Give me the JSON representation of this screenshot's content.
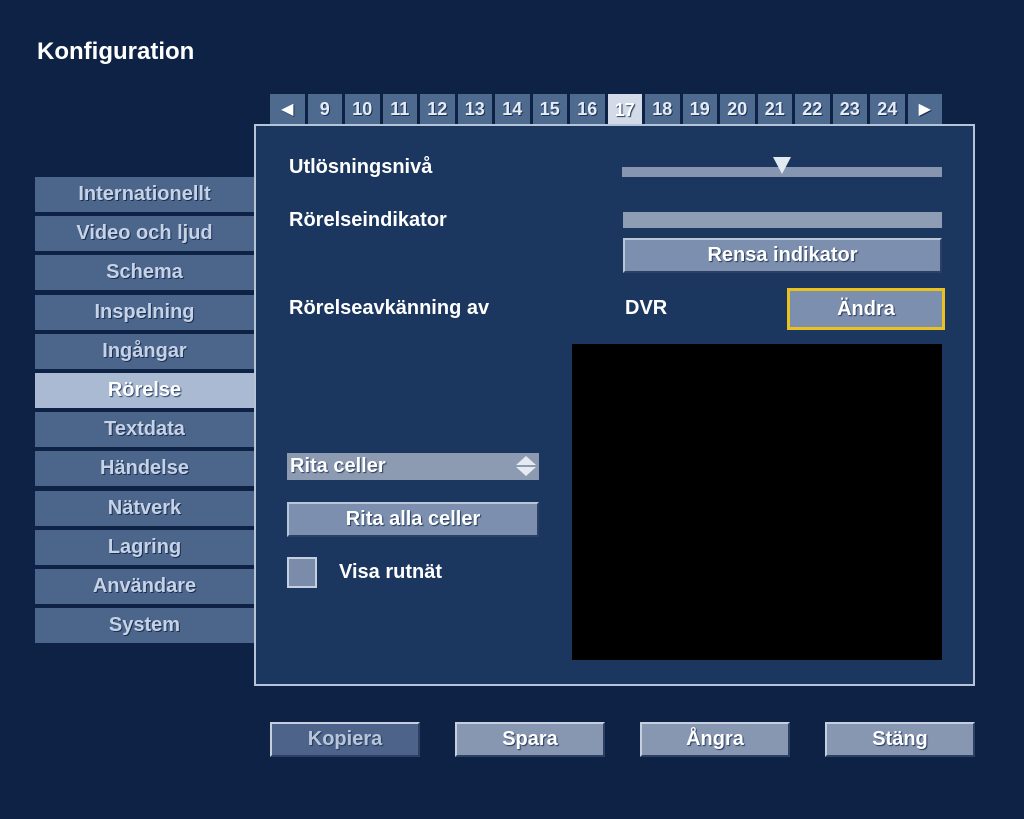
{
  "header": {
    "title": "Konfiguration"
  },
  "tabs": {
    "prev_icon": "◀",
    "next_icon": "▶",
    "items": [
      "9",
      "10",
      "11",
      "12",
      "13",
      "14",
      "15",
      "16",
      "17",
      "18",
      "19",
      "20",
      "21",
      "22",
      "23",
      "24"
    ],
    "active": "17"
  },
  "sidebar": {
    "items": [
      {
        "label": "Internationellt"
      },
      {
        "label": "Video och ljud"
      },
      {
        "label": "Schema"
      },
      {
        "label": "Inspelning"
      },
      {
        "label": "Ingångar"
      },
      {
        "label": "Rörelse"
      },
      {
        "label": "Textdata"
      },
      {
        "label": "Händelse"
      },
      {
        "label": "Nätverk"
      },
      {
        "label": "Lagring"
      },
      {
        "label": "Användare"
      },
      {
        "label": "System"
      }
    ],
    "active": "Rörelse"
  },
  "panel": {
    "trigger_level_label": "Utlösningsnivå",
    "trigger_level_value": 0.5,
    "motion_indicator_label": "Rörelseindikator",
    "clear_indicator_button": "Rensa indikator",
    "motion_detection_by_label": "Rörelseavkänning av",
    "motion_detection_by_value": "DVR",
    "change_button": "Ändra",
    "draw_mode_select": "Rita celler",
    "draw_all_button": "Rita alla celler",
    "show_grid_label": "Visa rutnät",
    "show_grid_checked": false
  },
  "footer": {
    "copy": "Kopiera",
    "save": "Spara",
    "undo": "Ångra",
    "close": "Stäng"
  },
  "colors": {
    "background": "#0d2245",
    "panel": "#1c375f",
    "focus_border": "#e9c21d"
  }
}
